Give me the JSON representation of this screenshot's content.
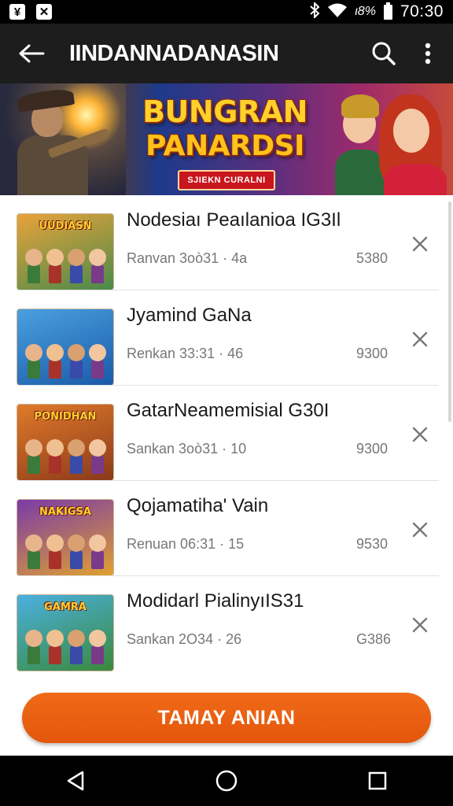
{
  "status_bar": {
    "time": "70:30",
    "battery_text": "ι8%",
    "left_icons": [
      "app-notification-icon",
      "app-notification-icon"
    ],
    "right_icons": [
      "bluetooth-icon",
      "wifi-icon",
      "battery-icon"
    ]
  },
  "app_bar": {
    "title": "IINDANNADANASIN",
    "icons": [
      "back-arrow-icon",
      "search-icon",
      "more-vert-icon"
    ]
  },
  "banner": {
    "title_line1": "BUNGRAN",
    "title_line2": "PANARDSI",
    "pill_text": "SJIEKN CURALNI"
  },
  "items": [
    {
      "title": "Nodesiaı Peaılanioa IG3Il",
      "meta": "Ranvan 3oò31 · 4a",
      "count": "5380",
      "thumb_text": "UUDIASN",
      "thumb_bg": [
        "#e8a33a",
        "#4a8a4a"
      ]
    },
    {
      "title": "Jyamind GaNa",
      "meta": "Renkan 33:31 · 46",
      "count": "9300",
      "thumb_text": "",
      "thumb_bg": [
        "#4aa0e0",
        "#1a5aa8"
      ]
    },
    {
      "title": "GatarNeamemisial G30I",
      "meta": "Sankan 3oò31 · 10",
      "count": "9300",
      "thumb_text": "PONIDHAN",
      "thumb_bg": [
        "#e07a2a",
        "#8a3a1a"
      ]
    },
    {
      "title": "Qojamatiha' Vain",
      "meta": "Renuan 06:31 · 15",
      "count": "9530",
      "thumb_text": "NAKIGSA",
      "thumb_bg": [
        "#7a3aa8",
        "#e0a030"
      ]
    },
    {
      "title": "Modidarl PialinyıIS31",
      "meta": "Sankan 2O34 · 26",
      "count": "G386",
      "thumb_text": "GAMRA",
      "thumb_bg": [
        "#4ab0e0",
        "#3a8a3a"
      ]
    }
  ],
  "cta": {
    "label": "TAMAY ANIAN"
  },
  "nav_bar": {
    "icons": [
      "back-triangle-icon",
      "home-circle-icon",
      "recents-square-icon"
    ]
  },
  "colors": {
    "accent": "#e65c10",
    "app_bar_bg": "#1d1d1d",
    "list_bg": "#ffffff"
  }
}
